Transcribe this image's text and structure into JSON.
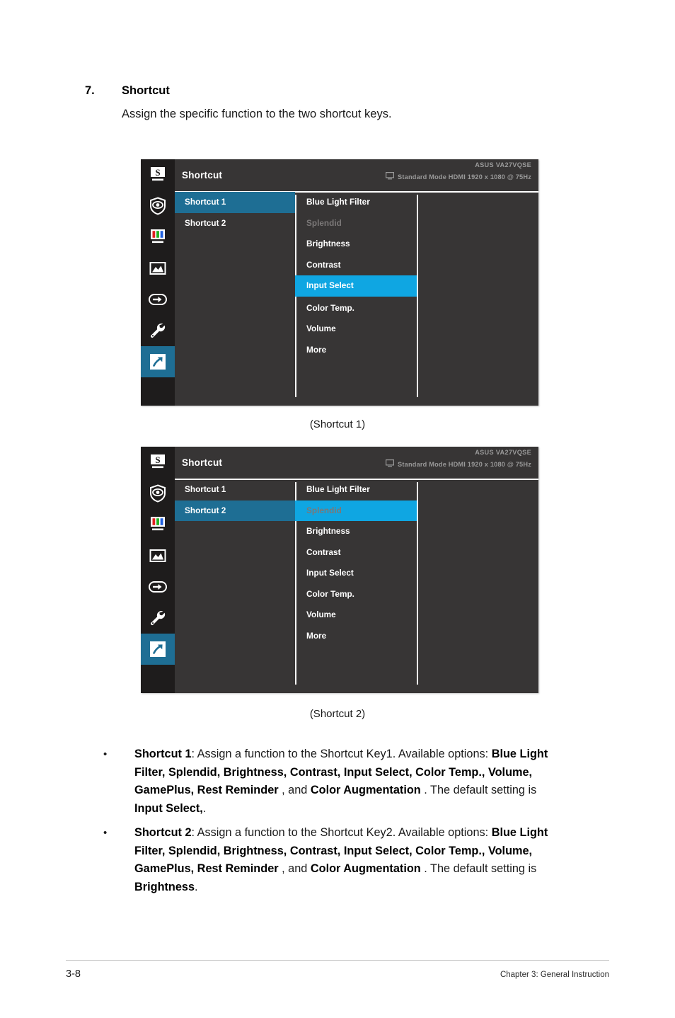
{
  "section": {
    "number": "7.",
    "title": "Shortcut",
    "intro": "Assign the specific function to the two shortcut keys."
  },
  "osd": {
    "title": "Shortcut",
    "model": "ASUS  VA27VQSE",
    "mode": "Standard Mode HDMI 1920 x 1080 @ 75Hz",
    "monitor_icon": "monitor-icon",
    "rail_icons": [
      {
        "name": "splendid-icon",
        "glyph": "S"
      },
      {
        "name": "eyecare-shield-icon",
        "glyph": "eye-shield"
      },
      {
        "name": "color-bars-icon",
        "glyph": "rgb-bars"
      },
      {
        "name": "image-picture-icon",
        "glyph": "mountain"
      },
      {
        "name": "input-select-icon",
        "glyph": "arrow-in-box"
      },
      {
        "name": "system-setup-wrench-icon",
        "glyph": "wrench"
      },
      {
        "name": "shortcut-arrow-icon",
        "glyph": "diagonal-arrow"
      }
    ],
    "left_column": [
      "Shortcut 1",
      "Shortcut 2"
    ],
    "menu_items": [
      "Blue Light Filter",
      "Splendid",
      "Brightness",
      "Contrast",
      "Input Select",
      "Color Temp.",
      "Volume",
      "More"
    ],
    "panel1": {
      "selected_left": "Shortcut 1",
      "selected_item": "Input Select",
      "disabled_item": "Splendid",
      "caption": "(Shortcut 1)"
    },
    "panel2": {
      "selected_left": "Shortcut 2",
      "selected_item": "Splendid",
      "disabled_item": "Splendid",
      "caption": "(Shortcut 2)"
    },
    "colors": {
      "panel_bg": "#373535",
      "rail_bg": "#1e1c1c",
      "select_dark": "#1e6e94",
      "select_bright": "#0fa6e2",
      "disabled_text": "#7b7878"
    }
  },
  "bullets": [
    {
      "label": "Shortcut 1",
      "text_1": ": Assign a function to the Shortcut Key1. Available options: ",
      "options": "Blue Light Filter, Splendid, Brightness, Contrast, Input Select, Color Temp., Volume, GamePlus, Rest Reminder ",
      "conj": ", and ",
      "last_option": "Color Augmentation",
      "text_2": " . The default setting is ",
      "default": "Input Select,",
      "period": "."
    },
    {
      "label": "Shortcut 2",
      "text_1": ": Assign a function to the Shortcut Key2. Available options: ",
      "options": "Blue Light Filter, Splendid, Brightness, Contrast, Input Select, Color Temp., Volume, GamePlus, Rest Reminder ",
      "conj": ", and ",
      "last_option": "Color Augmentation",
      "text_2": " . The default setting is ",
      "default": "Brightness",
      "period": "."
    }
  ],
  "footer": {
    "page": "3-8",
    "chapter": "Chapter 3: General Instruction"
  }
}
